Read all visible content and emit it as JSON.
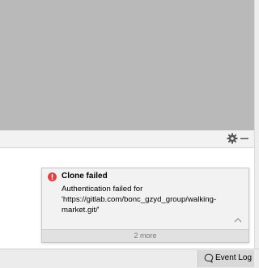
{
  "notification": {
    "type": "error",
    "title": "Clone failed",
    "message_lines": [
      "Authentication failed for",
      "'https://gitlab.com/bonc_gzyd_group/walking-",
      "market.git/'"
    ],
    "more_label": "2 more"
  },
  "tool_window": {
    "settings_icon": "gear-icon",
    "hide_icon": "minimize-icon"
  },
  "status_bar": {
    "event_log_label": "Event Log",
    "event_log_icon": "speech-bubble-icon"
  },
  "colors": {
    "upper_area": "#b9b9b9",
    "balloon_bg": "#f2f2f2",
    "error_red": "#d9434a",
    "status_bar": "#ececec"
  }
}
